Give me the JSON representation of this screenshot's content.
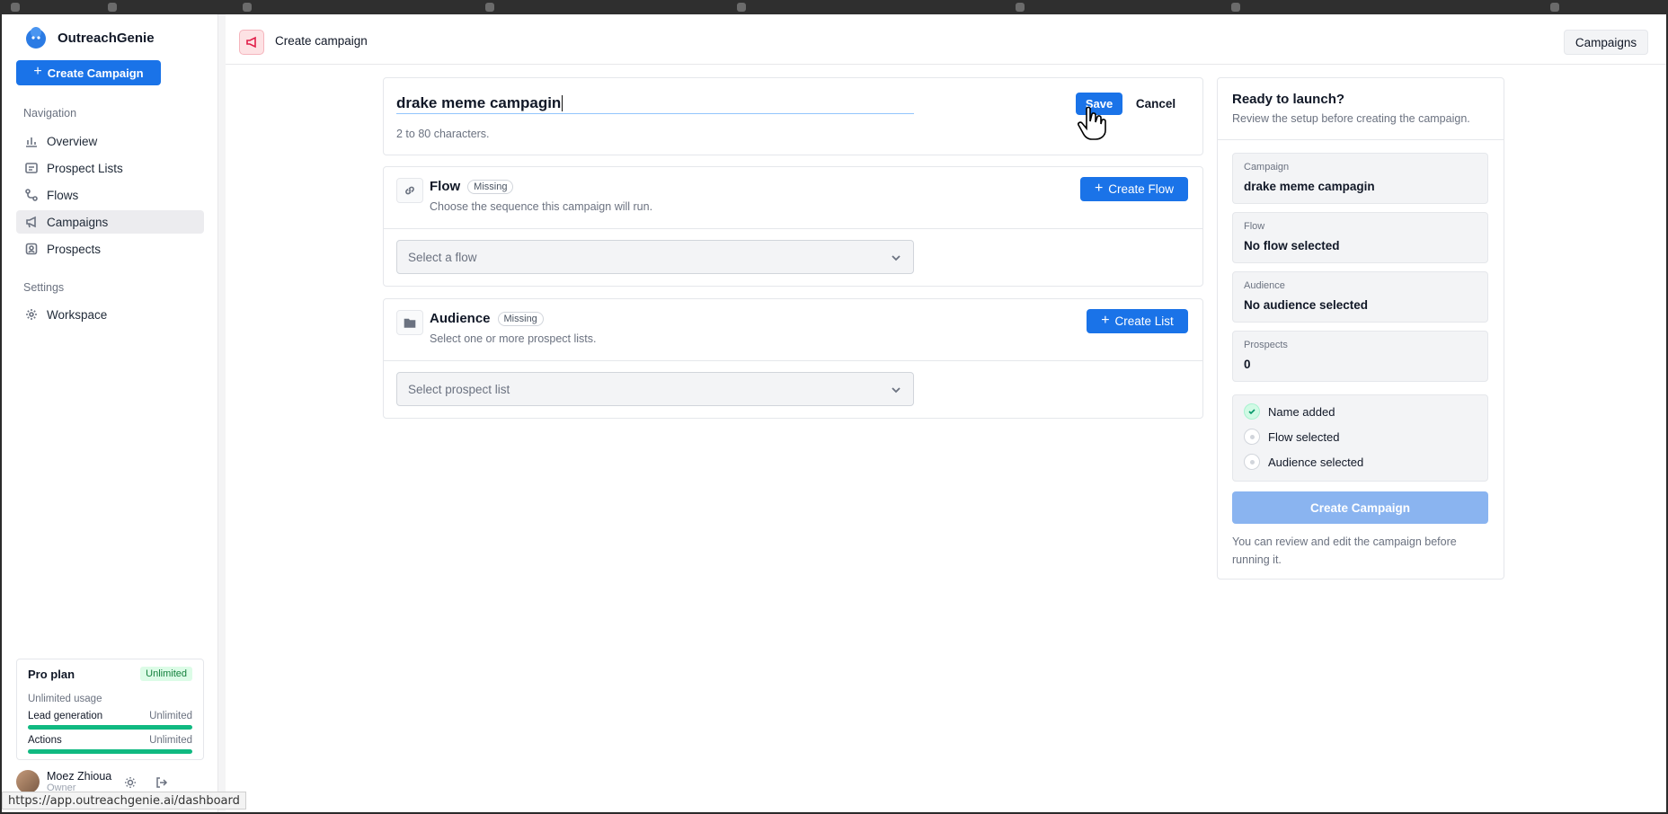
{
  "status_bar": {
    "url": "https://app.outreachgenie.ai/dashboard"
  },
  "sidebar": {
    "brand_name": "OutreachGenie",
    "create_button": "Create Campaign",
    "nav_heading": "Navigation",
    "nav_items": [
      {
        "label": "Overview",
        "icon": "bar-chart-icon",
        "active": false
      },
      {
        "label": "Prospect Lists",
        "icon": "list-icon",
        "active": false
      },
      {
        "label": "Flows",
        "icon": "flow-icon",
        "active": false
      },
      {
        "label": "Campaigns",
        "icon": "megaphone-icon",
        "active": true
      },
      {
        "label": "Prospects",
        "icon": "contact-icon",
        "active": false
      }
    ],
    "settings_heading": "Settings",
    "settings_items": [
      {
        "label": "Workspace",
        "icon": "gear-icon"
      }
    ],
    "plan": {
      "title": "Pro plan",
      "badge": "Unlimited",
      "subtitle": "Unlimited usage",
      "rows": [
        {
          "label": "Lead generation",
          "value": "Unlimited",
          "fill": 1.0
        },
        {
          "label": "Actions",
          "value": "Unlimited",
          "fill": 1.0
        }
      ]
    },
    "user": {
      "name": "Moez Zhioua",
      "role": "Owner"
    }
  },
  "header": {
    "title": "Create campaign",
    "campaigns_button": "Campaigns"
  },
  "name_card": {
    "value": "drake meme campagin",
    "hint": "2 to 80 characters.",
    "save_label": "Save",
    "cancel_label": "Cancel"
  },
  "flow_section": {
    "title": "Flow",
    "badge": "Missing",
    "description": "Choose the sequence this campaign will run.",
    "button": "Create Flow",
    "placeholder": "Select a flow"
  },
  "audience_section": {
    "title": "Audience",
    "badge": "Missing",
    "description": "Select one or more prospect lists.",
    "button": "Create List",
    "placeholder": "Select prospect list"
  },
  "summary": {
    "title": "Ready to launch?",
    "subtitle": "Review the setup before creating the campaign.",
    "fields": [
      {
        "label": "Campaign",
        "value": "drake meme campagin"
      },
      {
        "label": "Flow",
        "value": "No flow selected"
      },
      {
        "label": "Audience",
        "value": "No audience selected"
      },
      {
        "label": "Prospects",
        "value": "0"
      }
    ],
    "checklist": [
      {
        "label": "Name added",
        "done": true
      },
      {
        "label": "Flow selected",
        "done": false
      },
      {
        "label": "Audience selected",
        "done": false
      }
    ],
    "launch_button": "Create Campaign",
    "footnote": "You can review and edit the campaign before running it."
  },
  "colors": {
    "primary": "#1a73e8",
    "primary_disabled": "#8ab4f0",
    "success": "#10b981"
  }
}
